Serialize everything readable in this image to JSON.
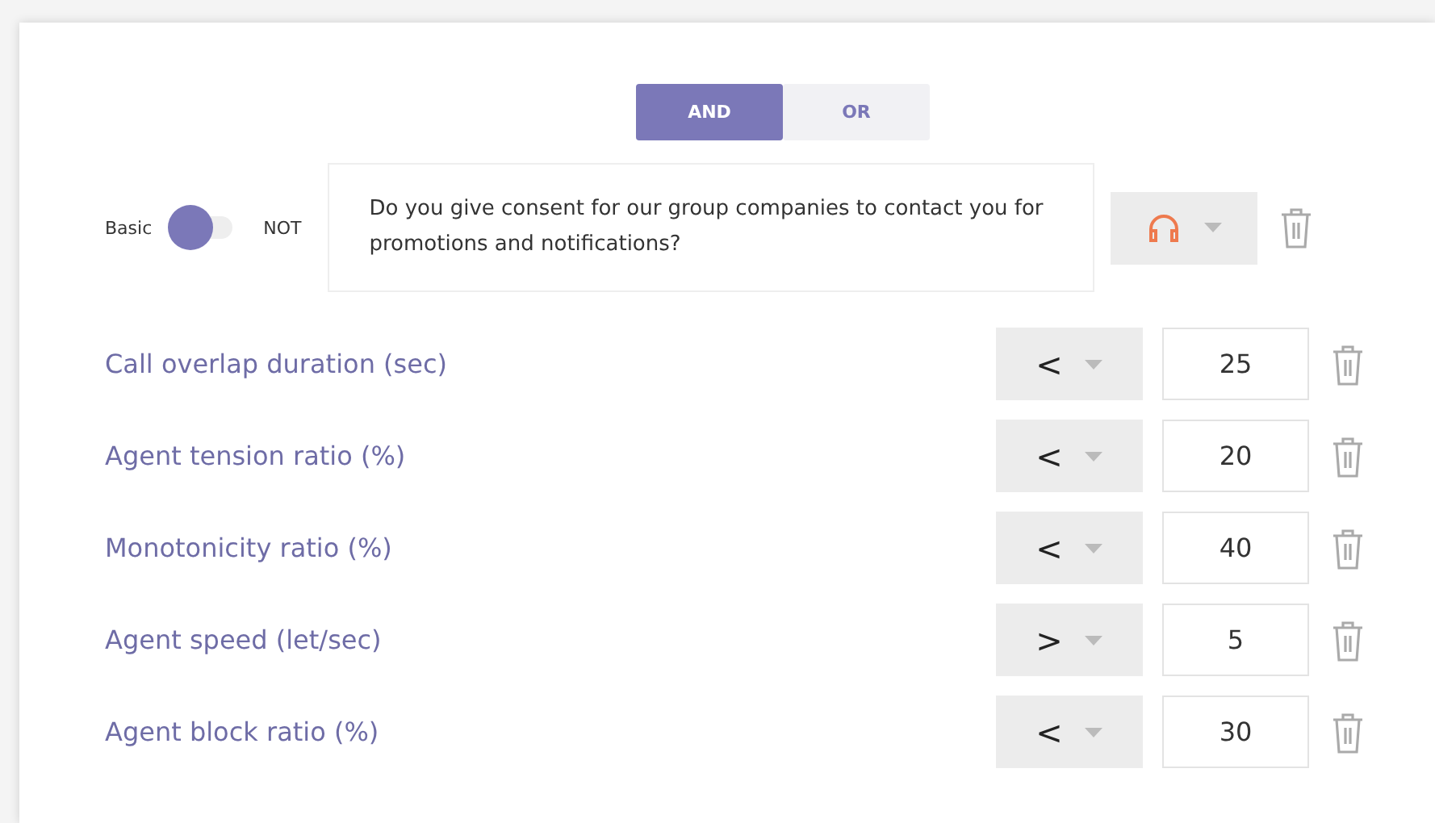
{
  "logic_tabs": [
    {
      "label": "AND",
      "selected": true
    },
    {
      "label": "OR",
      "selected": false
    }
  ],
  "consent_rule": {
    "left_label": "Basic",
    "right_label": "NOT",
    "not": false,
    "question": "Do you give consent for our group companies to contact you for promotions and notifications?"
  },
  "conditions": [
    {
      "label": "Call overlap duration (sec)",
      "operator": "<",
      "value": "25"
    },
    {
      "label": "Agent tension ratio (%)",
      "operator": "<",
      "value": "20"
    },
    {
      "label": "Monotonicity ratio (%)",
      "operator": "<",
      "value": "40"
    },
    {
      "label": "Agent speed (let/sec)",
      "operator": ">",
      "value": "5"
    },
    {
      "label": "Agent block ratio (%)",
      "operator": "<",
      "value": "30"
    }
  ]
}
